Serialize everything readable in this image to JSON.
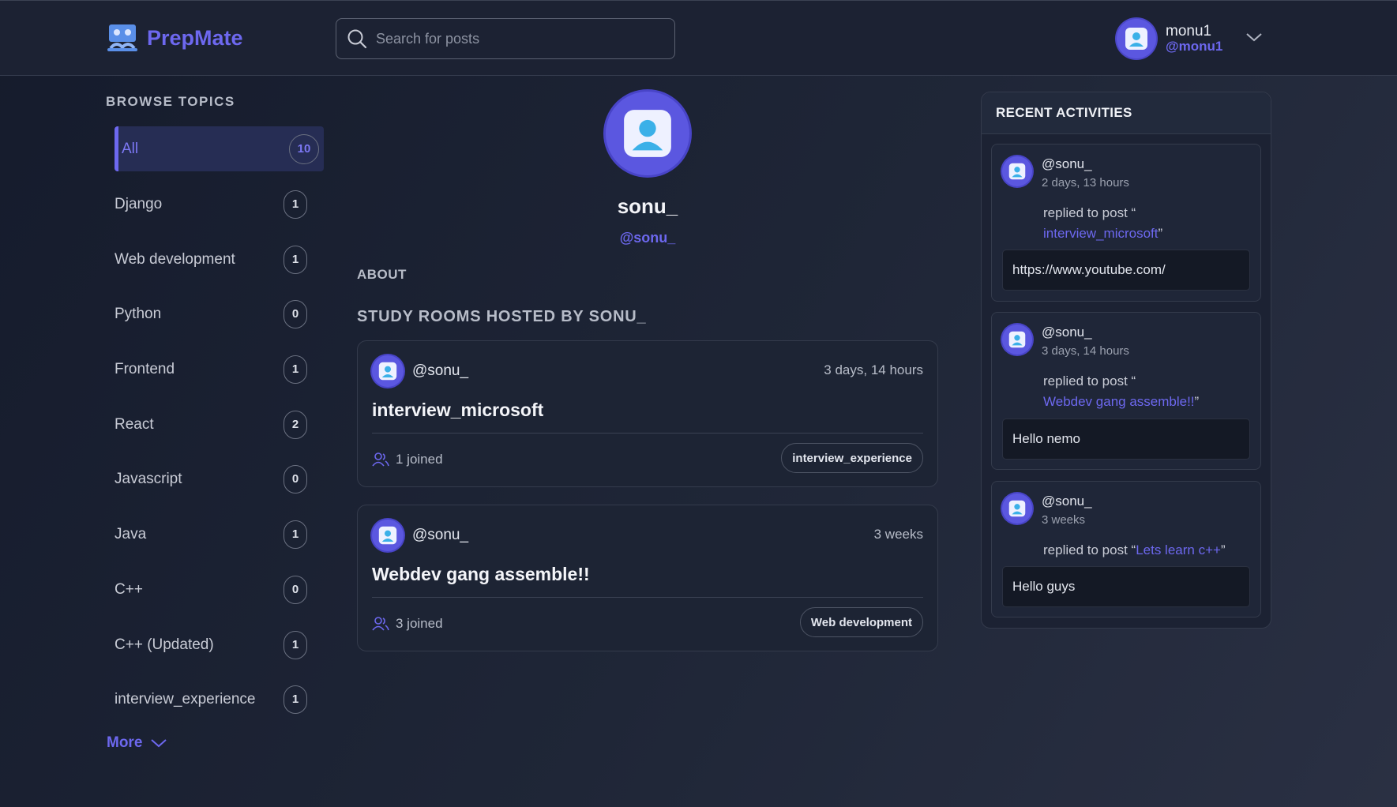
{
  "app": {
    "name": "PrepMate",
    "accent": "#6d68ef"
  },
  "search": {
    "placeholder": "Search for posts"
  },
  "current_user": {
    "name": "monu1",
    "handle": "@monu1"
  },
  "sidebar": {
    "title": "BROWSE TOPICS",
    "topics": [
      {
        "label": "All",
        "count": "10"
      },
      {
        "label": "Django",
        "count": "1"
      },
      {
        "label": "Web development",
        "count": "1"
      },
      {
        "label": "Python",
        "count": "0"
      },
      {
        "label": "Frontend",
        "count": "1"
      },
      {
        "label": "React",
        "count": "2"
      },
      {
        "label": "Javascript",
        "count": "0"
      },
      {
        "label": "Java",
        "count": "1"
      },
      {
        "label": "C++",
        "count": "0"
      },
      {
        "label": "C++ (Updated)",
        "count": "1"
      },
      {
        "label": "interview_experience",
        "count": "1"
      }
    ],
    "more_label": "More"
  },
  "profile": {
    "name": "sonu_",
    "handle": "@sonu_",
    "about_title": "ABOUT",
    "rooms_title": "STUDY ROOMS HOSTED BY SONU_"
  },
  "rooms": [
    {
      "host": "@sonu_",
      "time": "3 days, 14 hours",
      "title": "interview_microsoft",
      "joined": "1 joined",
      "tag": "interview_experience"
    },
    {
      "host": "@sonu_",
      "time": "3 weeks",
      "title": "Webdev gang assemble!!",
      "joined": "3 joined",
      "tag": "Web development"
    }
  ],
  "activities": {
    "title": "RECENT ACTIVITIES",
    "items": [
      {
        "user": "@sonu_",
        "time": "2 days, 13 hours",
        "prefix": "replied to post “",
        "post": "interview_microsoft",
        "suffix": "”",
        "reply": "https://www.youtube.com/"
      },
      {
        "user": "@sonu_",
        "time": "3 days, 14 hours",
        "prefix": "replied to post “",
        "post": "Webdev gang assemble!!",
        "suffix": "”",
        "reply": "Hello nemo"
      },
      {
        "user": "@sonu_",
        "time": "3 weeks",
        "prefix": "replied to post “",
        "post": "Lets learn c++",
        "suffix": "”",
        "reply": "Hello guys"
      }
    ]
  }
}
